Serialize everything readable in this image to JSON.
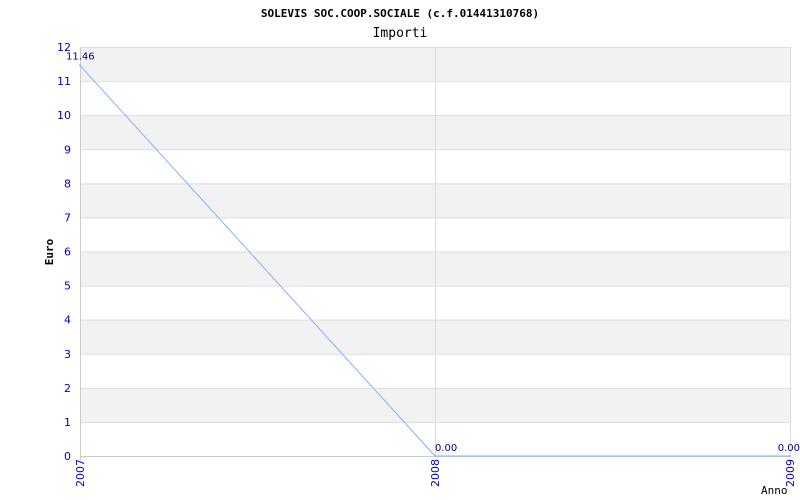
{
  "chart_data": {
    "type": "line",
    "title": "SOLEVIS SOC.COOP.SOCIALE (c.f.01441310768)",
    "subtitle": "Importi",
    "xlabel": "Anno",
    "ylabel": "Euro",
    "categories": [
      "2007",
      "2008",
      "2009"
    ],
    "values": [
      11.46,
      0.0,
      0.0
    ],
    "data_labels": [
      "11.46",
      "0.00",
      "0.00"
    ],
    "ylim": [
      0,
      12
    ],
    "yticks": [
      "0",
      "1",
      "2",
      "3",
      "4",
      "5",
      "6",
      "7",
      "8",
      "9",
      "10",
      "11",
      "12"
    ],
    "grid": true,
    "legend": "none",
    "colors": {
      "line": "#7fb2ff",
      "band": "#f2f2f2",
      "grid": "#dddddd",
      "tick_text": "#0000cc",
      "data_label": "#000080"
    }
  }
}
